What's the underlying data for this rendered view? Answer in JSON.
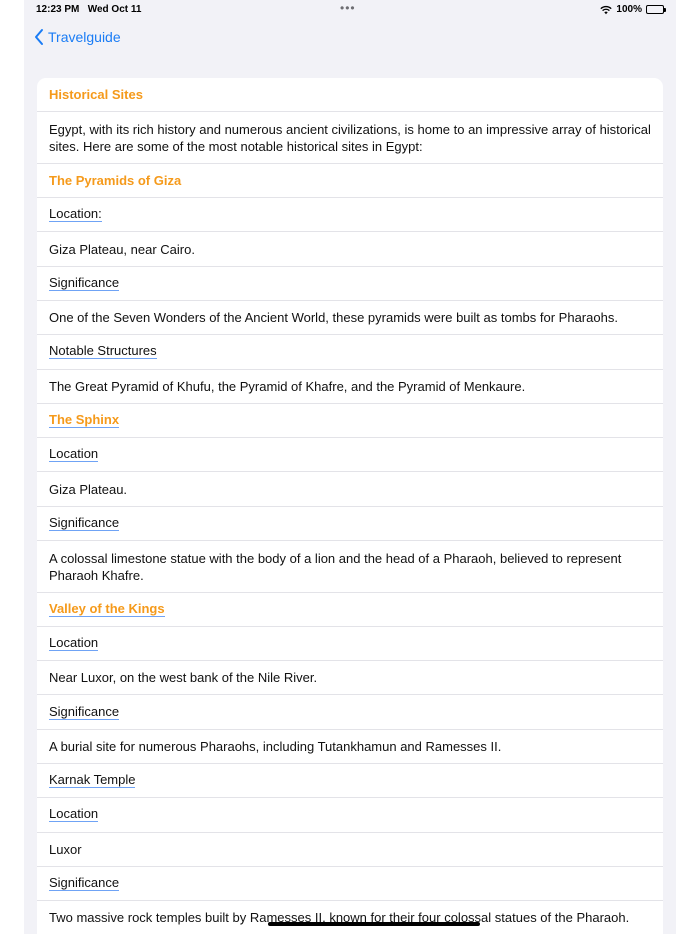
{
  "status_bar": {
    "time": "12:23 PM",
    "date": "Wed Oct 11",
    "dots": "•••",
    "battery": "100%"
  },
  "nav": {
    "back_label": "Travelguide"
  },
  "rows": [
    {
      "kind": "heading",
      "text": "Historical Sites"
    },
    {
      "kind": "text",
      "text": "Egypt, with its rich history and numerous ancient civilizations, is home to an impressive array of historical sites. Here are some of the most notable historical sites in Egypt:"
    },
    {
      "kind": "heading",
      "text": "The Pyramids of Giza"
    },
    {
      "kind": "link",
      "text": "Location:"
    },
    {
      "kind": "text",
      "text": " Giza Plateau, near Cairo."
    },
    {
      "kind": "link",
      "text": "Significance"
    },
    {
      "kind": "text",
      "text": "One of the Seven Wonders of the Ancient World, these pyramids were built as tombs for Pharaohs."
    },
    {
      "kind": "link",
      "text": "Notable Structures"
    },
    {
      "kind": "text",
      "text": "The Great Pyramid of Khufu, the Pyramid of Khafre, and the Pyramid of Menkaure."
    },
    {
      "kind": "heading-link",
      "text": "The Sphinx"
    },
    {
      "kind": "link",
      "text": "Location"
    },
    {
      "kind": "text",
      "text": "Giza Plateau."
    },
    {
      "kind": "link",
      "text": "Significance"
    },
    {
      "kind": "text",
      "text": "A colossal limestone statue with the body of a lion and the head of a Pharaoh, believed to represent Pharaoh Khafre."
    },
    {
      "kind": "heading-link",
      "text": "Valley of the Kings"
    },
    {
      "kind": "link",
      "text": "Location"
    },
    {
      "kind": "text",
      "text": "Near Luxor, on the west bank of the Nile River."
    },
    {
      "kind": "link",
      "text": "Significance"
    },
    {
      "kind": "text",
      "text": "A burial site for numerous Pharaohs, including Tutankhamun and Ramesses II."
    },
    {
      "kind": "link",
      "text": "Karnak Temple"
    },
    {
      "kind": "link",
      "text": "Location"
    },
    {
      "kind": "text",
      "text": "Luxor"
    },
    {
      "kind": "link",
      "text": "Significance"
    },
    {
      "kind": "text",
      "text": "Two massive rock temples built by Ramesses II, known for their four colossal statues of the Pharaoh."
    }
  ],
  "colors": {
    "accent_blue": "#1a7cf5",
    "heading_orange": "#f59a1b",
    "link_underline": "#6fa3f5",
    "background": "#f2f2f7"
  }
}
